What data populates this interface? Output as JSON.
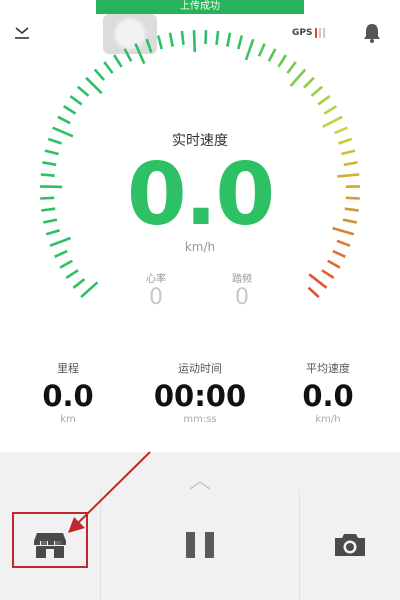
{
  "banner": {
    "text": "上传成功"
  },
  "topbar": {
    "gps_label": "GPS",
    "icons": [
      "collapse-icon",
      "drag-handle-icon",
      "gps-signal-icon",
      "bell-icon"
    ]
  },
  "gauge": {
    "title": "实时速度",
    "speed": "0.0",
    "unit": "km/h",
    "colors": {
      "low": "#2ec065",
      "mid": "#c9d43a",
      "high": "#e0502f"
    }
  },
  "heart_rate": {
    "label": "心率",
    "value": "0"
  },
  "cadence": {
    "label": "踏频",
    "value": "0"
  },
  "stats": {
    "distance": {
      "label": "里程",
      "value": "0.0",
      "unit": "km"
    },
    "duration": {
      "label": "运动时间",
      "value": "00:00",
      "unit": "mm:ss"
    },
    "avg_speed": {
      "label": "平均速度",
      "value": "0.0",
      "unit": "km/h"
    }
  },
  "bottom_bar": {
    "icons": [
      "store-icon",
      "pause-icon",
      "camera-icon"
    ]
  },
  "annotation": {
    "color": "#c0282e"
  }
}
